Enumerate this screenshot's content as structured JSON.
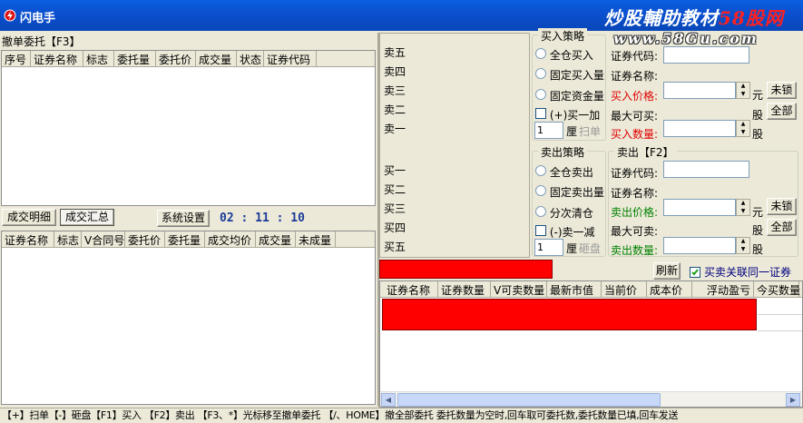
{
  "window": {
    "title": "闪电手"
  },
  "watermark": {
    "line1_main": "炒股輔助教材",
    "line1_brand": "58股网",
    "line2": "www.58Gu.com"
  },
  "cancel_panel": {
    "title": "撤单委托【F3】",
    "columns": [
      "序号",
      "证券名称",
      "标志",
      "委托量",
      "委托价",
      "成交量",
      "状态",
      "证券代码"
    ]
  },
  "tabs": {
    "detail": "成交明细",
    "summary": "成交汇总",
    "settings": "系统设置",
    "clock": "02 : 11 : 10"
  },
  "deal_panel": {
    "columns": [
      "证券名称",
      "标志",
      "V合同号",
      "委托价",
      "委托量",
      "成交均价",
      "成交量",
      "未成量"
    ]
  },
  "quotes": {
    "sell": [
      "卖五",
      "卖四",
      "卖三",
      "卖二",
      "卖一"
    ],
    "buy": [
      "买一",
      "买二",
      "买三",
      "买四",
      "买五"
    ]
  },
  "buy_strategy": {
    "title": "买入策略",
    "options": [
      "全仓买入",
      "固定买入量",
      "固定资金量"
    ],
    "plus_label": "(+)买一加",
    "tick_value": "1",
    "unit": "厘",
    "sweep": "扫单"
  },
  "sell_strategy": {
    "title": "卖出策略",
    "options": [
      "全仓卖出",
      "固定卖出量",
      "分次清仓"
    ],
    "minus_label": "(-)卖一减",
    "tick_value": "1",
    "unit": "厘",
    "sweep": "砸盘"
  },
  "buy_form": {
    "code_label": "证券代码:",
    "name_label": "证券名称:",
    "price_label": "买入价格:",
    "price_unit": "元",
    "lock_button": "未锁",
    "max_label": "最大可买:",
    "max_unit": "股",
    "all_button": "全部",
    "qty_label": "买入数量:",
    "qty_unit": "股"
  },
  "sell_form": {
    "title": "卖出【F2】",
    "code_label": "证券代码:",
    "name_label": "证券名称:",
    "price_label": "卖出价格:",
    "price_unit": "元",
    "lock_button": "未锁",
    "max_label": "最大可卖:",
    "max_unit": "股",
    "all_button": "全部",
    "qty_label": "卖出数量:",
    "qty_unit": "股"
  },
  "refresh_button": "刷新",
  "link_checkbox": {
    "label": "买卖关联同一证券",
    "checked": true
  },
  "holdings": {
    "columns": [
      "证券名称",
      "证券数量",
      "V可卖数量",
      "最新市值",
      "当前价",
      "成本价",
      "浮动盈亏",
      "今买数量"
    ]
  },
  "status_bar": "【+】扫单【-】砸盘【F1】买入 【F2】卖出  【F3、*】光标移至撤单委托  【/、HOME】撤全部委托  委托数量为空时,回车取可委托数,委托数量已填,回车发送",
  "colors": {
    "titlebar": "#0b4fcf",
    "redacted": "#ff0000",
    "price_label": "#e00000",
    "sell_label": "#008000"
  }
}
